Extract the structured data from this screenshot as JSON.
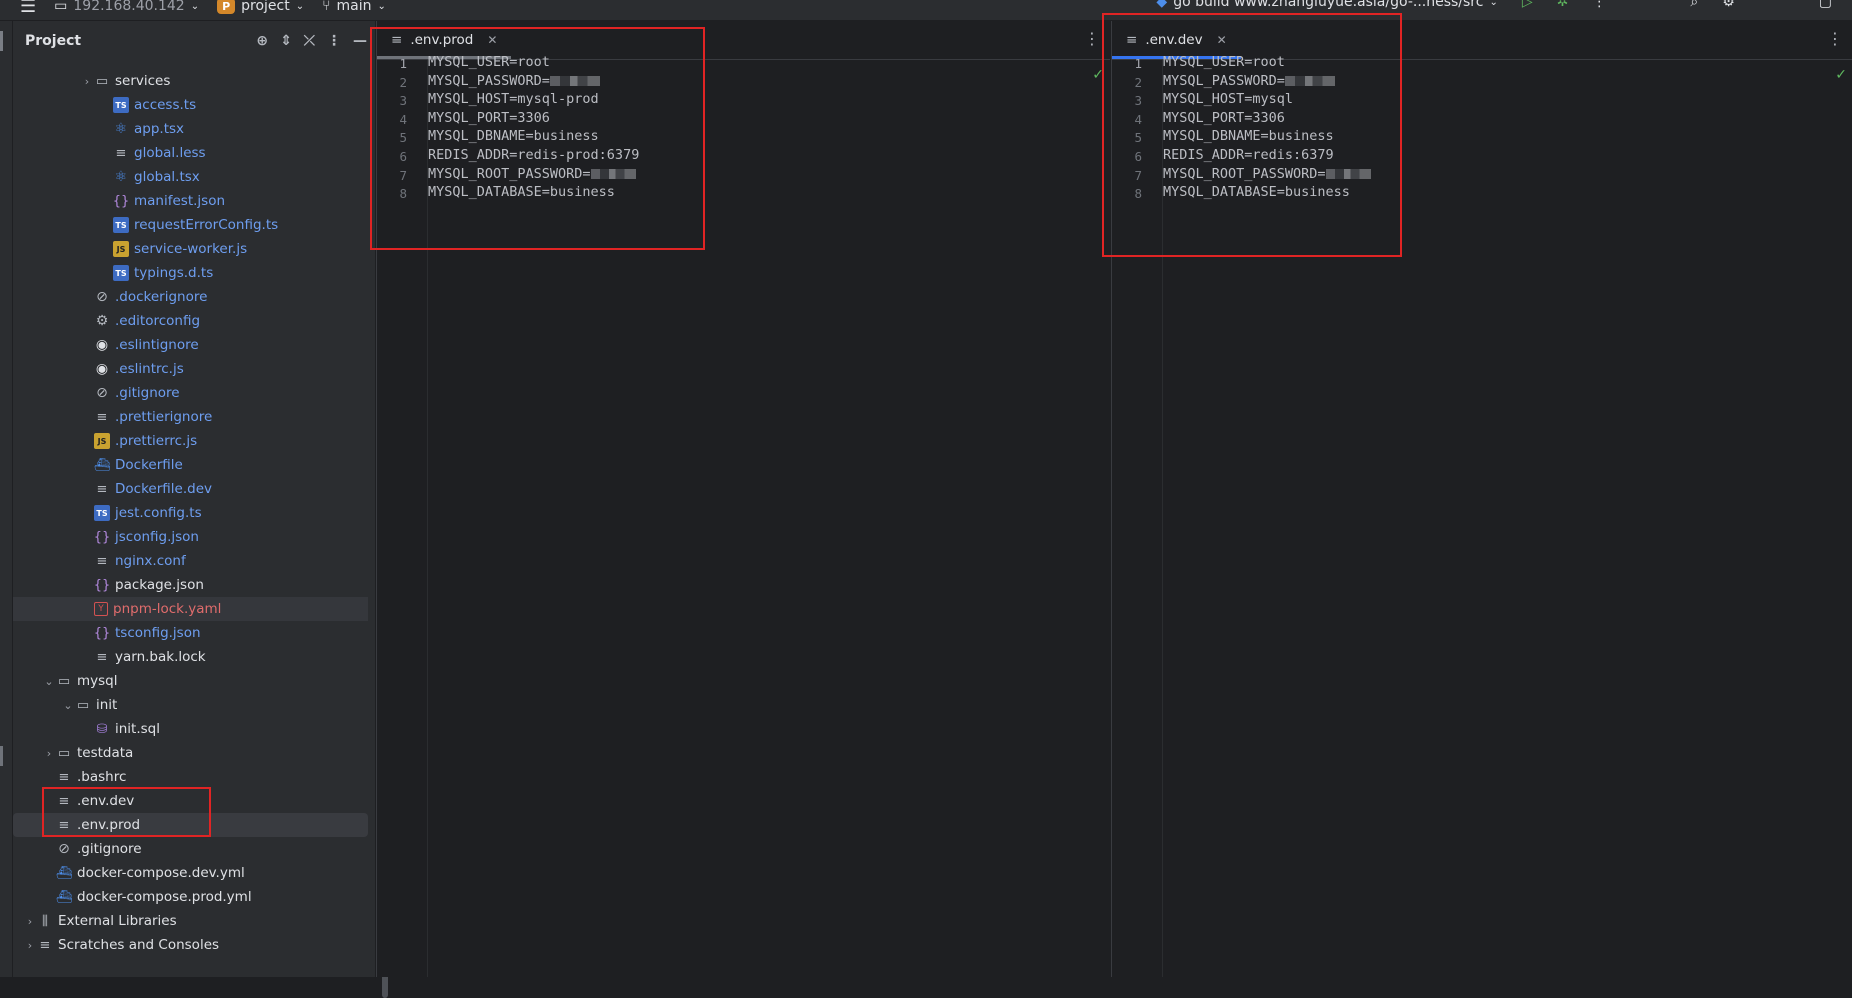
{
  "titlebar": {
    "host": "192.168.40.142",
    "project_badge": "P",
    "project_name": "project",
    "branch": "main",
    "run_config": "go build www.zhangluyue.asia/go-...ness/src"
  },
  "project_panel": {
    "title": "Project",
    "items": [
      {
        "label": "services",
        "icon": "folder-icon",
        "kind": "folder",
        "depth": 3,
        "expanded": false,
        "color": "default"
      },
      {
        "label": "access.ts",
        "icon": "typescript-icon",
        "kind": "ts",
        "depth": 4,
        "color": "blue"
      },
      {
        "label": "app.tsx",
        "icon": "react-icon",
        "kind": "react",
        "depth": 4,
        "color": "blue"
      },
      {
        "label": "global.less",
        "icon": "text-file-icon",
        "kind": "lines",
        "depth": 4,
        "color": "blue"
      },
      {
        "label": "global.tsx",
        "icon": "react-icon",
        "kind": "react",
        "depth": 4,
        "color": "blue"
      },
      {
        "label": "manifest.json",
        "icon": "json-icon",
        "kind": "json",
        "depth": 4,
        "color": "blue"
      },
      {
        "label": "requestErrorConfig.ts",
        "icon": "typescript-icon",
        "kind": "ts",
        "depth": 4,
        "color": "blue"
      },
      {
        "label": "service-worker.js",
        "icon": "javascript-icon",
        "kind": "js",
        "depth": 4,
        "color": "blue"
      },
      {
        "label": "typings.d.ts",
        "icon": "typescript-icon",
        "kind": "ts",
        "depth": 4,
        "color": "blue"
      },
      {
        "label": ".dockerignore",
        "icon": "ignore-icon",
        "kind": "ban",
        "depth": 3,
        "color": "blue"
      },
      {
        "label": ".editorconfig",
        "icon": "gear-icon",
        "kind": "gear",
        "depth": 3,
        "color": "blue"
      },
      {
        "label": ".eslintignore",
        "icon": "eslint-icon",
        "kind": "eslint",
        "depth": 3,
        "color": "blue"
      },
      {
        "label": ".eslintrc.js",
        "icon": "eslint-icon",
        "kind": "eslint",
        "depth": 3,
        "color": "blue"
      },
      {
        "label": ".gitignore",
        "icon": "ignore-icon",
        "kind": "ban",
        "depth": 3,
        "color": "blue"
      },
      {
        "label": ".prettierignore",
        "icon": "text-file-icon",
        "kind": "lines",
        "depth": 3,
        "color": "blue"
      },
      {
        "label": ".prettierrc.js",
        "icon": "javascript-icon",
        "kind": "js",
        "depth": 3,
        "color": "blue"
      },
      {
        "label": "Dockerfile",
        "icon": "docker-icon",
        "kind": "docker",
        "depth": 3,
        "color": "blue"
      },
      {
        "label": "Dockerfile.dev",
        "icon": "text-file-icon",
        "kind": "lines",
        "depth": 3,
        "color": "blue"
      },
      {
        "label": "jest.config.ts",
        "icon": "typescript-icon",
        "kind": "ts",
        "depth": 3,
        "color": "blue"
      },
      {
        "label": "jsconfig.json",
        "icon": "json-icon",
        "kind": "json",
        "depth": 3,
        "color": "blue"
      },
      {
        "label": "nginx.conf",
        "icon": "text-file-icon",
        "kind": "lines",
        "depth": 3,
        "color": "blue"
      },
      {
        "label": "package.json",
        "icon": "json-icon",
        "kind": "json",
        "depth": 3,
        "color": "default"
      },
      {
        "label": "pnpm-lock.yaml",
        "icon": "yaml-icon",
        "kind": "yaml",
        "depth": 3,
        "color": "red",
        "highlight": "hover"
      },
      {
        "label": "tsconfig.json",
        "icon": "json-icon",
        "kind": "json",
        "depth": 3,
        "color": "blue"
      },
      {
        "label": "yarn.bak.lock",
        "icon": "text-file-icon",
        "kind": "lines",
        "depth": 3,
        "color": "default"
      },
      {
        "label": "mysql",
        "icon": "folder-icon",
        "kind": "folder",
        "depth": 1,
        "expanded": true,
        "color": "default"
      },
      {
        "label": "init",
        "icon": "folder-icon",
        "kind": "folder",
        "depth": 2,
        "expanded": true,
        "color": "default"
      },
      {
        "label": "init.sql",
        "icon": "database-icon",
        "kind": "db",
        "depth": 3,
        "color": "default"
      },
      {
        "label": "testdata",
        "icon": "folder-icon",
        "kind": "folder",
        "depth": 1,
        "expanded": false,
        "color": "default"
      },
      {
        "label": ".bashrc",
        "icon": "text-file-icon",
        "kind": "lines",
        "depth": 1,
        "color": "default"
      },
      {
        "label": ".env.dev",
        "icon": "text-file-icon",
        "kind": "lines",
        "depth": 1,
        "color": "default"
      },
      {
        "label": ".env.prod",
        "icon": "text-file-icon",
        "kind": "lines",
        "depth": 1,
        "color": "default",
        "highlight": "selected"
      },
      {
        "label": ".gitignore",
        "icon": "ignore-icon",
        "kind": "ban",
        "depth": 1,
        "color": "default"
      },
      {
        "label": "docker-compose.dev.yml",
        "icon": "docker-icon",
        "kind": "docker",
        "depth": 1,
        "color": "default"
      },
      {
        "label": "docker-compose.prod.yml",
        "icon": "docker-icon",
        "kind": "docker",
        "depth": 1,
        "color": "default"
      },
      {
        "label": "External Libraries",
        "icon": "library-icon",
        "kind": "lib",
        "depth": 0,
        "expanded": false,
        "color": "default"
      },
      {
        "label": "Scratches and Consoles",
        "icon": "scratches-icon",
        "kind": "lines",
        "depth": 0,
        "expanded": false,
        "color": "default"
      }
    ]
  },
  "editor_left": {
    "tab": ".env.prod",
    "tab_underline_color": "#6f737a",
    "lines": [
      {
        "n": "1",
        "text": "MYSQL_USER=root"
      },
      {
        "n": "2",
        "text": "MYSQL_PASSWORD=",
        "redacted": true
      },
      {
        "n": "3",
        "text": "MYSQL_HOST=mysql-prod"
      },
      {
        "n": "4",
        "text": "MYSQL_PORT=3306"
      },
      {
        "n": "5",
        "text": "MYSQL_DBNAME=business"
      },
      {
        "n": "6",
        "text": "REDIS_ADDR=redis-prod:6379"
      },
      {
        "n": "7",
        "text": "MYSQL_ROOT_PASSWORD=",
        "redacted": true
      },
      {
        "n": "8",
        "text": "MYSQL_DATABASE=business"
      }
    ]
  },
  "editor_right": {
    "tab": ".env.dev",
    "tab_underline_color": "#3574f0",
    "lines": [
      {
        "n": "1",
        "text": "MYSQL_USER=root"
      },
      {
        "n": "2",
        "text": "MYSQL_PASSWORD=",
        "redacted": true
      },
      {
        "n": "3",
        "text": "MYSQL_HOST=mysql"
      },
      {
        "n": "4",
        "text": "MYSQL_PORT=3306"
      },
      {
        "n": "5",
        "text": "MYSQL_DBNAME=business"
      },
      {
        "n": "6",
        "text": "REDIS_ADDR=redis:6379"
      },
      {
        "n": "7",
        "text": "MYSQL_ROOT_PASSWORD=",
        "redacted": true
      },
      {
        "n": "8",
        "text": "MYSQL_DATABASE=business"
      }
    ]
  },
  "colors": {
    "accent": "#3574f0",
    "annotation_box": "#e02424",
    "check": "#5fb85f"
  }
}
